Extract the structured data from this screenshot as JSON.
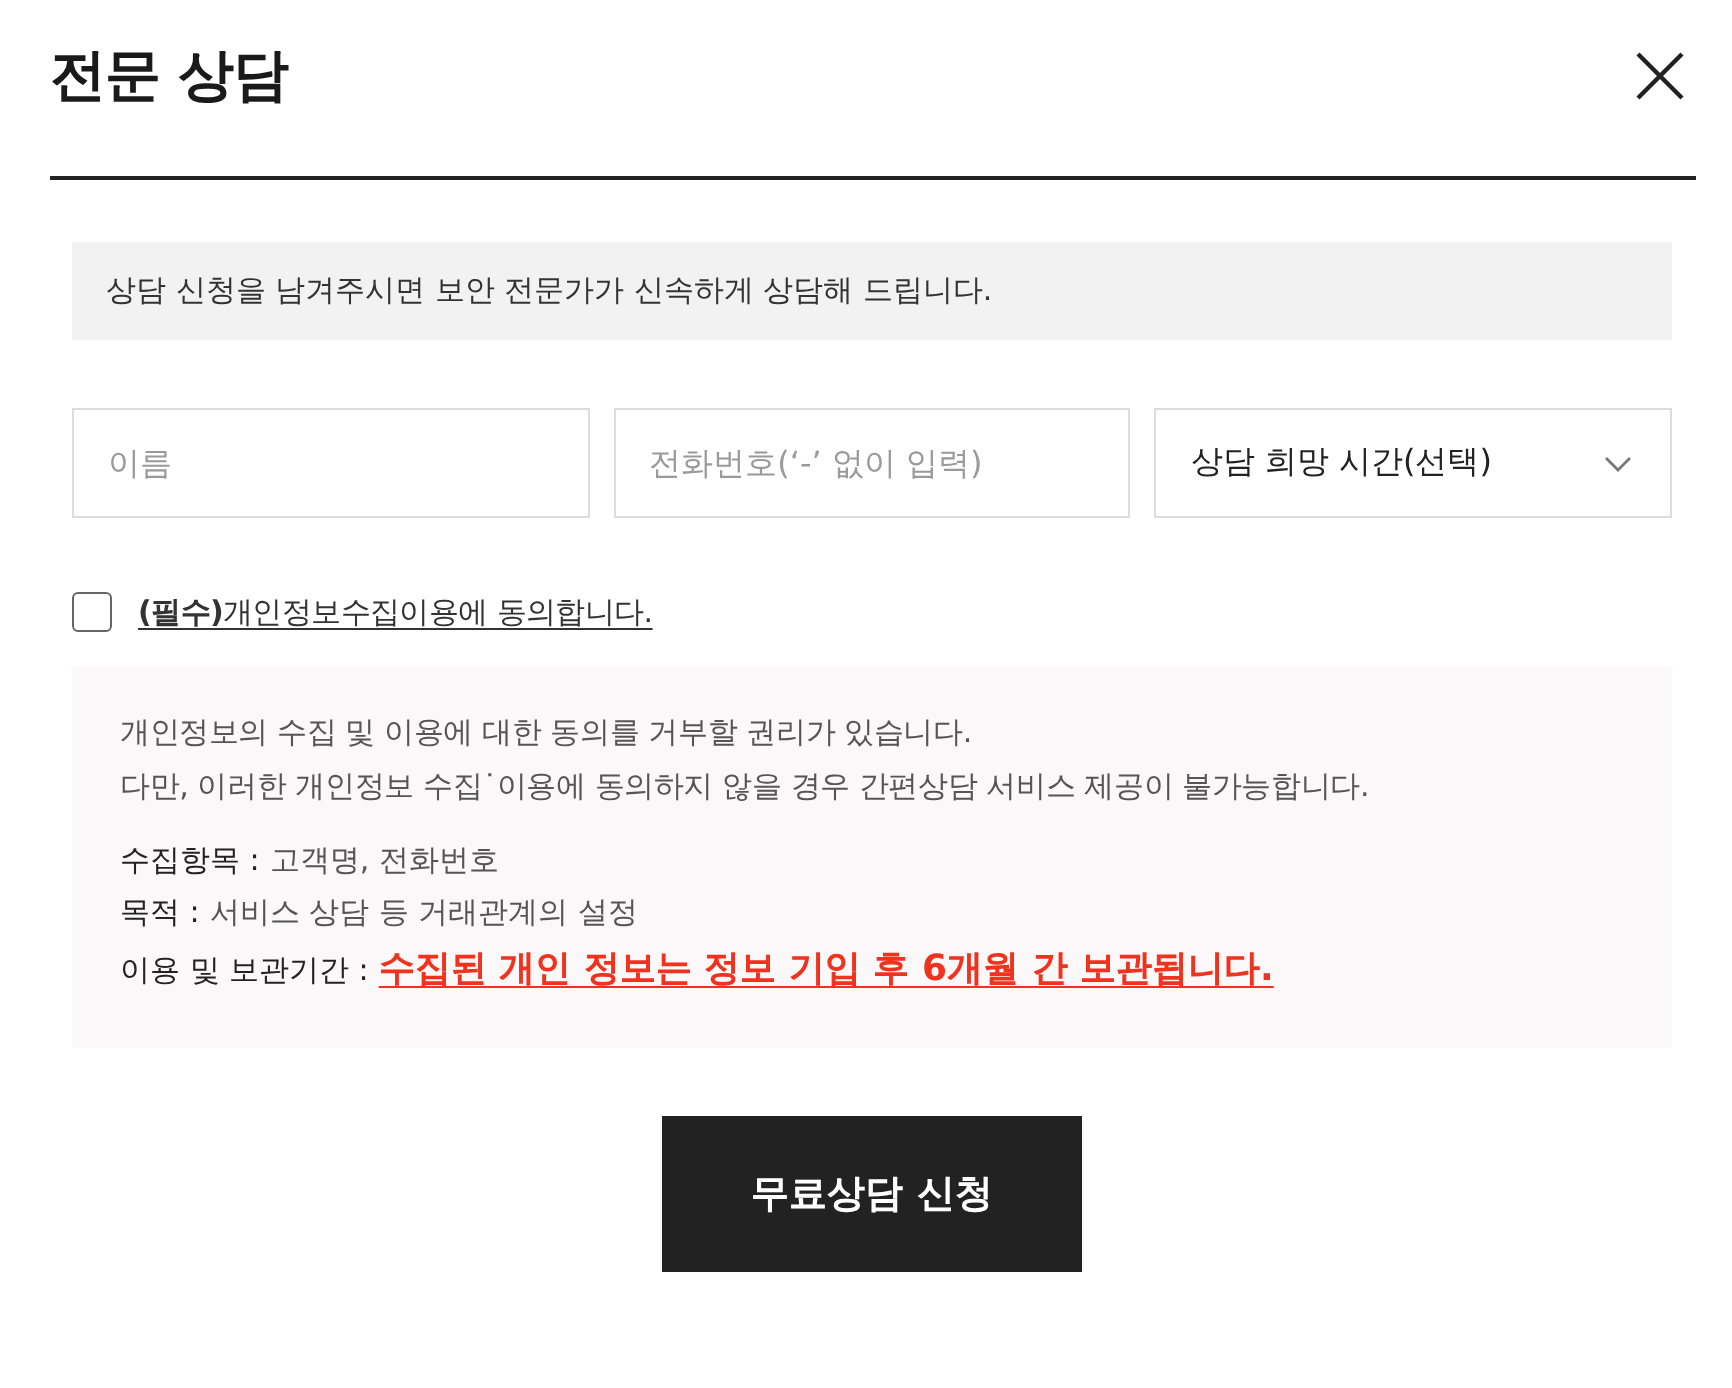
{
  "dialog": {
    "title": "전문 상담"
  },
  "notice": "상담 신청을 남겨주시면 보안 전문가가 신속하게 상담해 드립니다.",
  "form": {
    "fields": [
      {
        "kind": "input",
        "placeholder": "이름"
      },
      {
        "kind": "input",
        "placeholder": "전화번호(‘-’ 없이 입력)"
      },
      {
        "kind": "select",
        "value": "상담 희망 시간(선택)"
      }
    ],
    "consent": {
      "label": "**(필수)**개인정보수집이용에 동의합니다.",
      "checked": false
    }
  },
  "privacy_info": {
    "paragraph": [
      "개인정보의 수집 및 이용에 대한 동의를 거부할 권리가 있습니다.",
      "다만, 이러한 개인정보 수집˙이용에 동의하지 않을 경우 간편상담 서비스 제공이 불가능합니다."
    ],
    "items": [
      {
        "kind": "plain",
        "label": "수집항목 :",
        "value": "고객명, 전화번호"
      },
      {
        "kind": "plain",
        "label": "목적 :",
        "value": "서비스 상담 등 거래관계의 설정"
      },
      {
        "kind": "emphasis",
        "label": "이용 및 보관기간 :",
        "value": "수집된 개인 정보는 정보 기입 후 6개월 간 보관됩니다."
      }
    ]
  },
  "submit_button": "무료상담 신청"
}
